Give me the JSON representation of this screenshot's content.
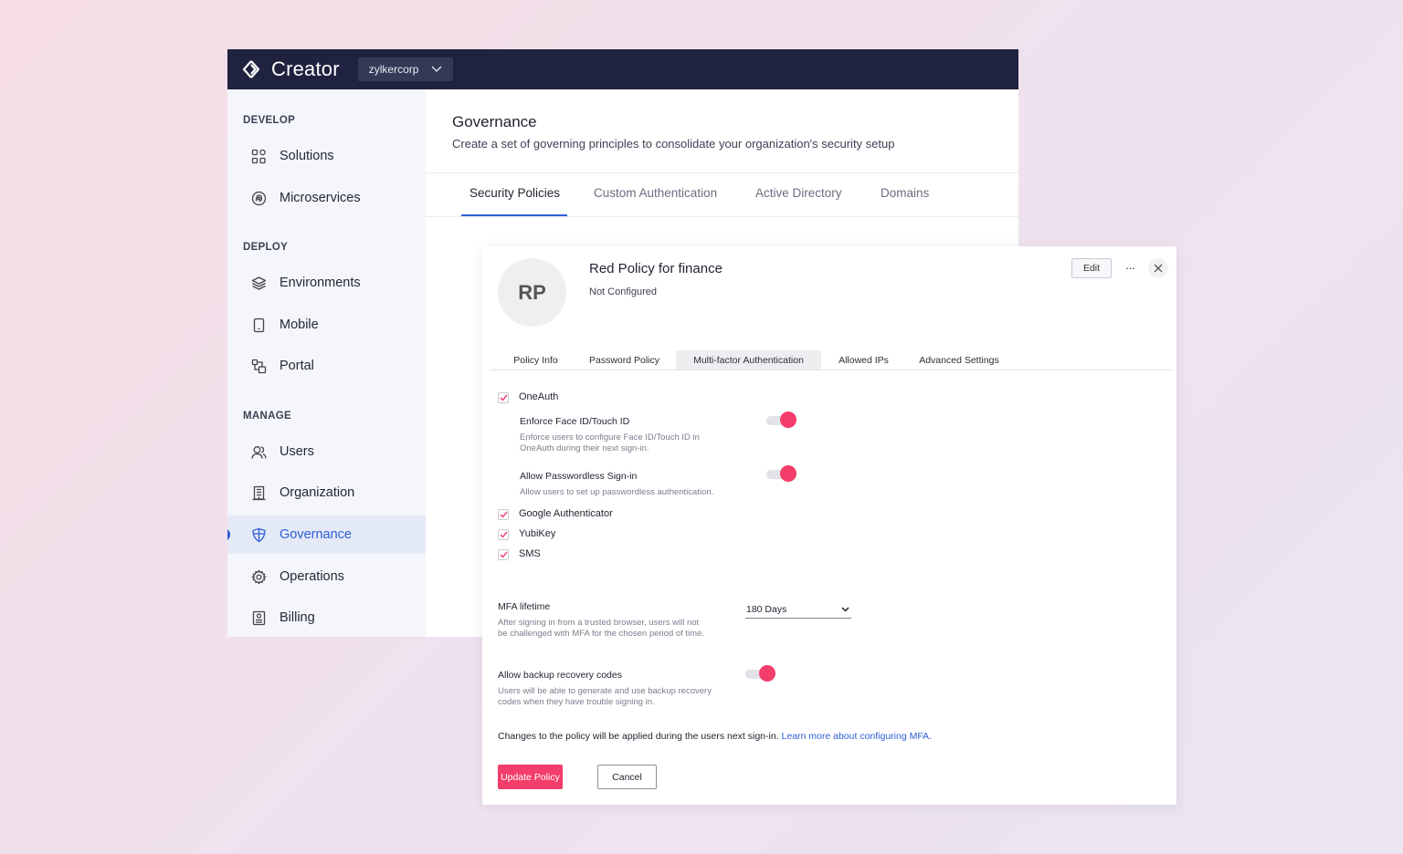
{
  "app": {
    "name": "Creator",
    "org": "zylkercorp"
  },
  "sidebar": {
    "sections": [
      {
        "label": "DEVELOP",
        "items": [
          {
            "label": "Solutions",
            "icon": "grid-icon"
          },
          {
            "label": "Microservices",
            "icon": "microservices-icon"
          }
        ]
      },
      {
        "label": "DEPLOY",
        "items": [
          {
            "label": "Environments",
            "icon": "layers-icon"
          },
          {
            "label": "Mobile",
            "icon": "mobile-icon"
          },
          {
            "label": "Portal",
            "icon": "portal-icon"
          }
        ]
      },
      {
        "label": "MANAGE",
        "items": [
          {
            "label": "Users",
            "icon": "users-icon"
          },
          {
            "label": "Organization",
            "icon": "building-icon"
          },
          {
            "label": "Governance",
            "icon": "shield-icon",
            "active": true
          },
          {
            "label": "Operations",
            "icon": "gear-icon"
          },
          {
            "label": "Billing",
            "icon": "billing-icon"
          }
        ]
      }
    ]
  },
  "main": {
    "title": "Governance",
    "subtitle": "Create a set of governing principles to consolidate your organization's security setup",
    "tabs": [
      "Security Policies",
      "Custom Authentication",
      "Active Directory",
      "Domains"
    ],
    "active_tab": "Security Policies"
  },
  "dialog": {
    "avatar_initials": "RP",
    "title": "Red Policy for finance",
    "status": "Not Configured",
    "edit_label": "Edit",
    "more_label": "···",
    "tabs": [
      "Policy Info",
      "Password Policy",
      "Multi-factor Authentication",
      "Allowed IPs",
      "Advanced Settings"
    ],
    "active_tab": "Multi-factor Authentication",
    "oneauth": {
      "label": "OneAuth",
      "checked": true,
      "options": [
        {
          "title": "Enforce Face ID/Touch ID",
          "desc_line1": "Enforce users to configure Face ID/Touch ID in",
          "desc_line2": "OneAuth during their next sign-in.",
          "enabled": true
        },
        {
          "title": "Allow Passwordless Sign-in",
          "desc_line1": "Allow users to set up passwordless authentication.",
          "enabled": true
        }
      ]
    },
    "methods": [
      {
        "label": "Google Authenticator",
        "checked": true
      },
      {
        "label": "YubiKey",
        "checked": true
      },
      {
        "label": "SMS",
        "checked": true
      }
    ],
    "mfa_lifetime": {
      "title": "MFA lifetime",
      "desc_line1": "After signing in from a trusted browser, users will not",
      "desc_line2": "be challenged with MFA for the chosen period of time.",
      "value": "180 Days"
    },
    "backup_codes": {
      "title": "Allow backup recovery codes",
      "desc_line1": "Users will be able to generate and use backup recovery",
      "desc_line2": "codes when they have trouble signing in.",
      "enabled": true
    },
    "note_text": "Changes to the policy will be applied during the users next sign-in. ",
    "note_link": "Learn more about configuring MFA.",
    "update_label": "Update Policy",
    "cancel_label": "Cancel"
  },
  "colors": {
    "topbar": "#1f2340",
    "accent_blue": "#2f5ed6",
    "accent_pink": "#f33d6a",
    "sidebar_bg": "#f4f6fb"
  }
}
